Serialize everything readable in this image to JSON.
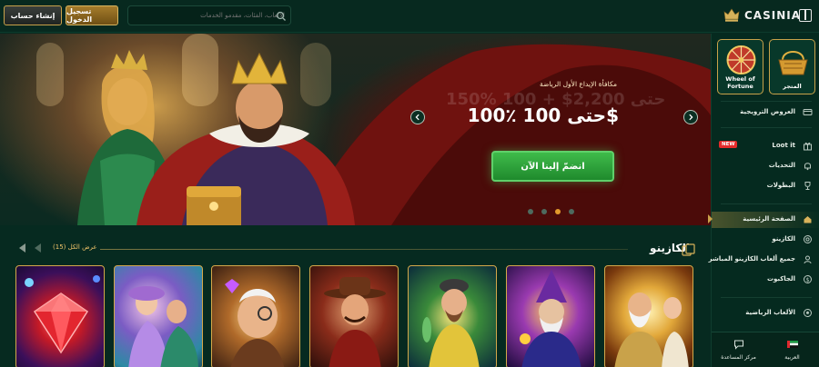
{
  "header": {
    "signup_label": "إنشاء حساب",
    "login_label": "تسجيل الدخول",
    "search_placeholder": "الألعاب، الفئات، مقدمو الخدمات",
    "logo_text": "CASINIA"
  },
  "hero": {
    "subtitle": "مكافأة الإيداع الأول الرياضة",
    "ghost_text": "150% حتى 2,200$ + 100",
    "title": "100٪ حتى 100$",
    "cta_label": "انضمّ إلينا الآن",
    "slides": 4,
    "active_slide": 3
  },
  "section": {
    "title": "الكازينو",
    "show_all": "عرض الكل (15)"
  },
  "games": [
    "game-1",
    "game-2",
    "game-3",
    "game-4",
    "game-5",
    "game-6",
    "game-7"
  ],
  "sidebar": {
    "tiles": [
      {
        "label": "Wheel of Fortune"
      },
      {
        "label": "المتجر"
      }
    ],
    "items": [
      {
        "label": "العروض الترويجية"
      },
      {
        "label": "Loot it",
        "badge": "NEW"
      },
      {
        "label": "التحديات"
      },
      {
        "label": "البطولات"
      },
      {
        "label": "الصفحة الرئيسية"
      },
      {
        "label": "الكازينو"
      },
      {
        "label": "جميع ألعاب الكازينو المباشر"
      },
      {
        "label": "الجاكبوت"
      },
      {
        "label": "الألعاب الرياضية"
      }
    ],
    "footer": {
      "help_label": "مركز المساعدة",
      "lang_label": "العربية"
    }
  },
  "colors": {
    "background": "#062a20",
    "accent_gold": "#c9a24a",
    "cta_green": "#2fa53c",
    "active_dot": "#e29a2c"
  }
}
